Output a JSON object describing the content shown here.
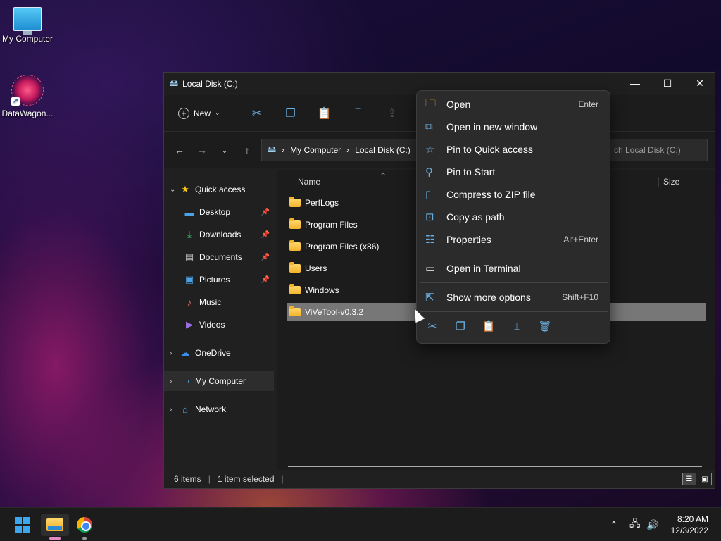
{
  "desktop": {
    "icons": [
      {
        "label": "My Computer"
      },
      {
        "label": "DataWagon..."
      }
    ]
  },
  "window": {
    "title": "Local Disk (C:)",
    "controls": {
      "minimize": "—",
      "maximize": "☐",
      "close": "✕"
    },
    "toolbar": {
      "new_label": "New"
    },
    "address": {
      "crumbs": [
        "My Computer",
        "Local Disk (C:)"
      ],
      "search_placeholder": "ch Local Disk (C:)"
    },
    "nav": {
      "quick_access": "Quick access",
      "items": [
        {
          "label": "Desktop"
        },
        {
          "label": "Downloads"
        },
        {
          "label": "Documents"
        },
        {
          "label": "Pictures"
        },
        {
          "label": "Music"
        },
        {
          "label": "Videos"
        }
      ],
      "onedrive": "OneDrive",
      "my_computer": "My Computer",
      "network": "Network"
    },
    "columns": {
      "name": "Name",
      "size": "Size"
    },
    "files": [
      {
        "name": "PerfLogs"
      },
      {
        "name": "Program Files"
      },
      {
        "name": "Program Files (x86)"
      },
      {
        "name": "Users"
      },
      {
        "name": "Windows"
      },
      {
        "name": "ViVeTool-v0.3.2"
      }
    ],
    "status": {
      "items": "6 items",
      "selected": "1 item selected"
    }
  },
  "context_menu": {
    "items": [
      {
        "label": "Open",
        "shortcut": "Enter",
        "icon": "folder-open-icon"
      },
      {
        "label": "Open in new window",
        "shortcut": "",
        "icon": "new-window-icon"
      },
      {
        "label": "Pin to Quick access",
        "shortcut": "",
        "icon": "star-icon"
      },
      {
        "label": "Pin to Start",
        "shortcut": "",
        "icon": "pin-icon"
      },
      {
        "label": "Compress to ZIP file",
        "shortcut": "",
        "icon": "zip-icon"
      },
      {
        "label": "Copy as path",
        "shortcut": "",
        "icon": "copy-path-icon"
      },
      {
        "label": "Properties",
        "shortcut": "Alt+Enter",
        "icon": "properties-icon"
      },
      {
        "label": "Open in Terminal",
        "shortcut": "",
        "icon": "terminal-icon"
      },
      {
        "label": "Show more options",
        "shortcut": "Shift+F10",
        "icon": "more-options-icon"
      }
    ]
  },
  "taskbar": {
    "time": "8:20 AM",
    "date": "12/3/2022"
  },
  "colors": {
    "accent": "#6bb0e3",
    "selected_row": "#777777"
  }
}
